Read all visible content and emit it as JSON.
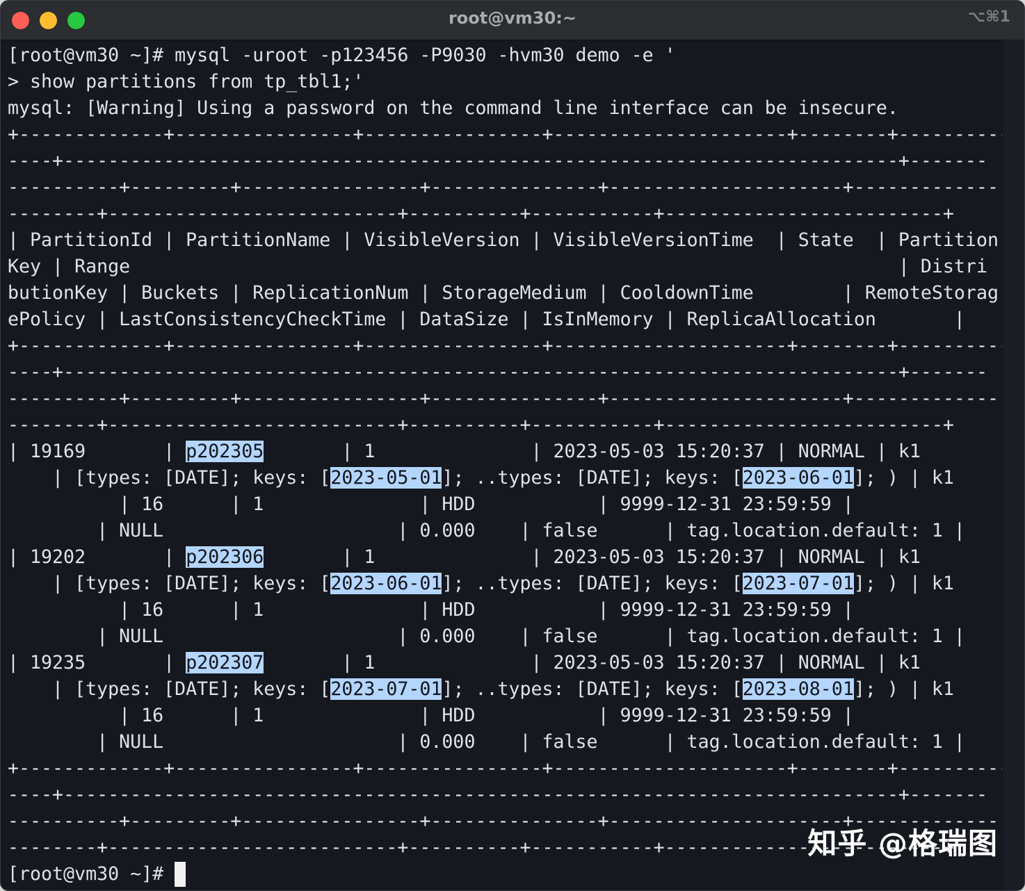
{
  "window": {
    "title": "root@vm30:~",
    "shortcut": "⌥⌘1"
  },
  "terminal": {
    "lines": [
      {
        "segments": [
          {
            "text": "[root@vm30 ~]# mysql -uroot -p123456 -P9030 -hvm30 demo -e '"
          }
        ]
      },
      {
        "segments": [
          {
            "text": "> show partitions from tp_tbl1;'"
          }
        ]
      },
      {
        "segments": [
          {
            "text": "mysql: [Warning] Using a password on the command line interface can be insecure."
          }
        ]
      },
      {
        "segments": [
          {
            "text": "+-------------+----------------+----------------+---------------------+--------+----------"
          }
        ]
      },
      {
        "segments": [
          {
            "text": "----+---------------------------------------------------------------------------+-------"
          }
        ]
      },
      {
        "segments": [
          {
            "text": "----------+---------+----------------+---------------+---------------------+-------------"
          }
        ]
      },
      {
        "segments": [
          {
            "text": "--------+--------------------------+----------+-----------+-------------------------+"
          }
        ]
      },
      {
        "segments": [
          {
            "text": "| PartitionId | PartitionName | VisibleVersion | VisibleVersionTime  | State  | Partition"
          }
        ]
      },
      {
        "segments": [
          {
            "text": "Key | Range                                                                     | Distri"
          }
        ]
      },
      {
        "segments": [
          {
            "text": "butionKey | Buckets | ReplicationNum | StorageMedium | CooldownTime        | RemoteStorag"
          }
        ]
      },
      {
        "segments": [
          {
            "text": "ePolicy | LastConsistencyCheckTime | DataSize | IsInMemory | ReplicaAllocation       |"
          }
        ]
      },
      {
        "segments": [
          {
            "text": "+-------------+----------------+----------------+---------------------+--------+----------"
          }
        ]
      },
      {
        "segments": [
          {
            "text": "----+---------------------------------------------------------------------------+-------"
          }
        ]
      },
      {
        "segments": [
          {
            "text": "----------+---------+----------------+---------------+---------------------+-------------"
          }
        ]
      },
      {
        "segments": [
          {
            "text": "--------+--------------------------+----------+-----------+-------------------------+"
          }
        ]
      },
      {
        "segments": [
          {
            "text": "| 19169       | "
          },
          {
            "text": "p202305",
            "hl": true
          },
          {
            "text": "       | 1              | 2023-05-03 15:20:37 | NORMAL | k1"
          }
        ]
      },
      {
        "segments": [
          {
            "text": "    | [types: [DATE]; keys: ["
          },
          {
            "text": "2023-05-01",
            "hl": true
          },
          {
            "text": "]; ..types: [DATE]; keys: ["
          },
          {
            "text": "2023-06-01",
            "hl": true
          },
          {
            "text": "]; ) | k1"
          }
        ]
      },
      {
        "segments": [
          {
            "text": "          | 16      | 1              | HDD           | 9999-12-31 23:59:59 |"
          }
        ]
      },
      {
        "segments": [
          {
            "text": "        | NULL                     | 0.000    | false      | tag.location.default: 1 |"
          }
        ]
      },
      {
        "segments": [
          {
            "text": "| 19202       | "
          },
          {
            "text": "p202306",
            "hl": true
          },
          {
            "text": "       | 1              | 2023-05-03 15:20:37 | NORMAL | k1"
          }
        ]
      },
      {
        "segments": [
          {
            "text": "    | [types: [DATE]; keys: ["
          },
          {
            "text": "2023-06-01",
            "hl": true
          },
          {
            "text": "]; ..types: [DATE]; keys: ["
          },
          {
            "text": "2023-07-01",
            "hl": true
          },
          {
            "text": "]; ) | k1"
          }
        ]
      },
      {
        "segments": [
          {
            "text": "          | 16      | 1              | HDD           | 9999-12-31 23:59:59 |"
          }
        ]
      },
      {
        "segments": [
          {
            "text": "        | NULL                     | 0.000    | false      | tag.location.default: 1 |"
          }
        ]
      },
      {
        "segments": [
          {
            "text": "| 19235       | "
          },
          {
            "text": "p202307",
            "hl": true
          },
          {
            "text": "       | 1              | 2023-05-03 15:20:37 | NORMAL | k1"
          }
        ]
      },
      {
        "segments": [
          {
            "text": "    | [types: [DATE]; keys: ["
          },
          {
            "text": "2023-07-01",
            "hl": true
          },
          {
            "text": "]; ..types: [DATE]; keys: ["
          },
          {
            "text": "2023-08-01",
            "hl": true
          },
          {
            "text": "]; ) | k1"
          }
        ]
      },
      {
        "segments": [
          {
            "text": "          | 16      | 1              | HDD           | 9999-12-31 23:59:59 |"
          }
        ]
      },
      {
        "segments": [
          {
            "text": "        | NULL                     | 0.000    | false      | tag.location.default: 1 |"
          }
        ]
      },
      {
        "segments": [
          {
            "text": "+-------------+----------------+----------------+---------------------+--------+----------"
          }
        ]
      },
      {
        "segments": [
          {
            "text": "----+---------------------------------------------------------------------------+-------"
          }
        ]
      },
      {
        "segments": [
          {
            "text": "----------+---------+----------------+---------------+---------------------+-------------"
          }
        ]
      },
      {
        "segments": [
          {
            "text": "--------+--------------------------+----------+-----------+-------------------------+"
          }
        ]
      },
      {
        "segments": [
          {
            "text": "[root@vm30 ~]# "
          }
        ],
        "cursor": true
      }
    ]
  },
  "watermark": "知乎 @格瑞图"
}
